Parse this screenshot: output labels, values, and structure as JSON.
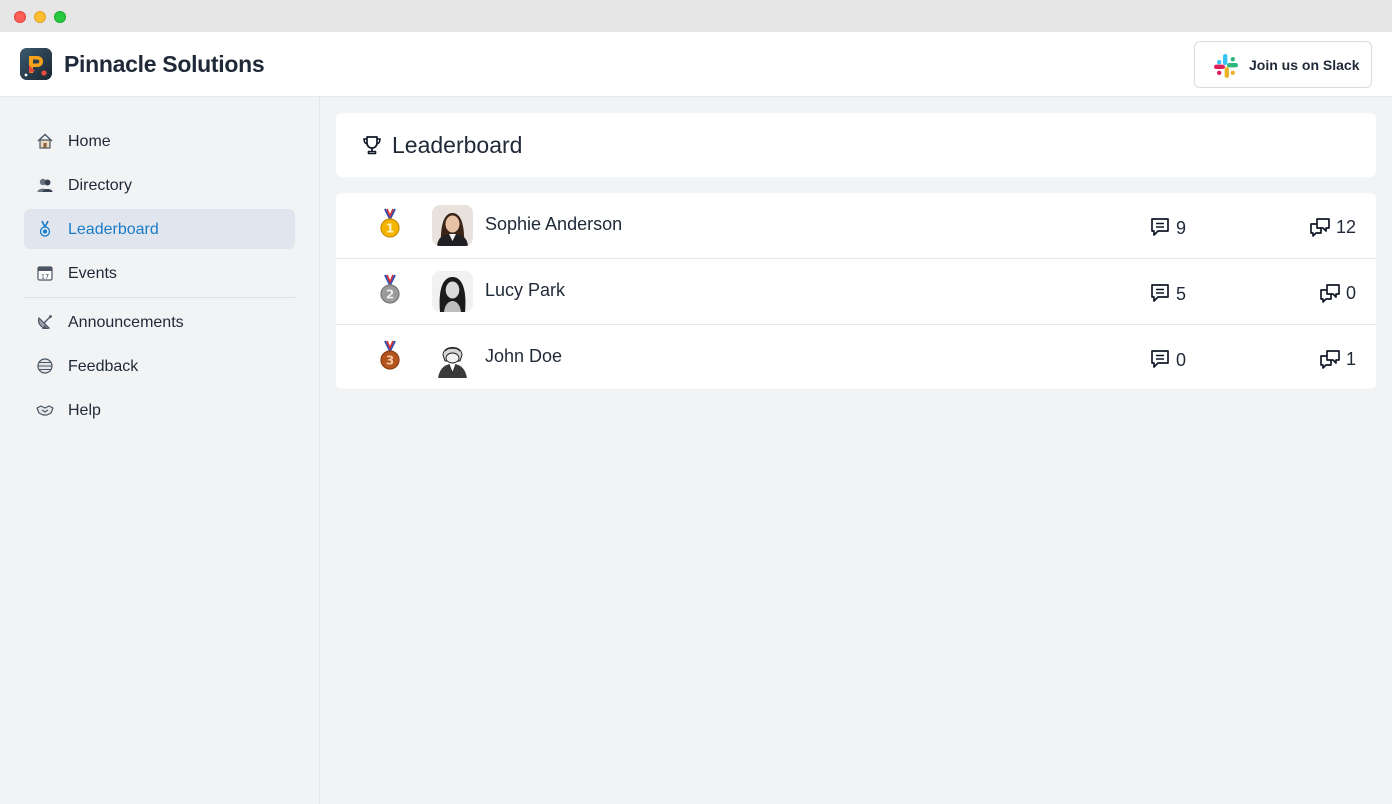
{
  "header": {
    "brand": "Pinnacle Solutions",
    "slack_label": "Join us on Slack"
  },
  "sidebar": {
    "items": [
      {
        "label": "Home",
        "icon": "house-icon"
      },
      {
        "label": "Directory",
        "icon": "people-icon"
      },
      {
        "label": "Leaderboard",
        "icon": "medal-icon",
        "active": true
      },
      {
        "label": "Events",
        "icon": "calendar-icon"
      },
      {
        "label": "Announcements",
        "icon": "satellite-dish-icon"
      },
      {
        "label": "Feedback",
        "icon": "globe-icon"
      },
      {
        "label": "Help",
        "icon": "handshake-icon"
      }
    ]
  },
  "main": {
    "title": "Leaderboard",
    "title_icon": "trophy-icon"
  },
  "leaderboard": [
    {
      "rank": "1",
      "name": "Sophie Anderson",
      "posts": "9",
      "replies": "12",
      "medal": "gold-medal-icon"
    },
    {
      "rank": "2",
      "name": "Lucy Park",
      "posts": "5",
      "replies": "0",
      "medal": "silver-medal-icon"
    },
    {
      "rank": "3",
      "name": "John Doe",
      "posts": "0",
      "replies": "1",
      "medal": "bronze-medal-icon"
    }
  ],
  "colors": {
    "accent": "#1a7bc7",
    "active_bg": "#e1e6ee",
    "gold": "#f4b400",
    "silver": "#9a9a9a",
    "bronze": "#b3541e"
  }
}
